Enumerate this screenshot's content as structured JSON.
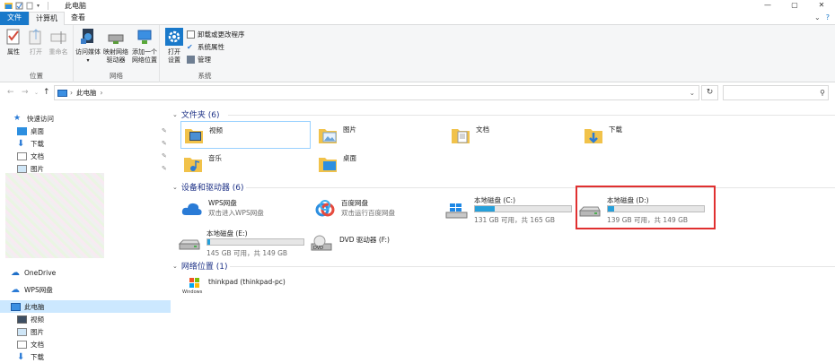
{
  "window": {
    "title": "此电脑"
  },
  "ribbon_tabs": [
    "文件",
    "计算机",
    "查看"
  ],
  "ribbon": {
    "location_group": {
      "label": "位置",
      "properties": "属性",
      "open": "打开",
      "rename": "重命名"
    },
    "network_group": {
      "label": "网络",
      "access_media": "访问媒体",
      "map_drive": "映射网络\n驱动器",
      "add_location": "添加一个\n网络位置"
    },
    "system_group": {
      "label": "系统",
      "open_settings": "打开\n设置",
      "uninstall": "卸载或更改程序",
      "sys_props": "系统属性",
      "manage": "管理"
    }
  },
  "address": {
    "path": "此电脑",
    "search_placeholder": ""
  },
  "nav": {
    "quick_access": "快速访问",
    "qa_items": [
      "桌面",
      "下载",
      "文档",
      "图片"
    ],
    "onedrive": "OneDrive",
    "wps": "WPS网盘",
    "this_pc": "此电脑",
    "pc_items": [
      "视频",
      "图片",
      "文档",
      "下载"
    ]
  },
  "sections": {
    "folders": "文件夹 (6)",
    "devices": "设备和驱动器 (6)",
    "network": "网络位置 (1)"
  },
  "folders": [
    "视频",
    "图片",
    "文档",
    "下载",
    "音乐",
    "桌面"
  ],
  "apps": [
    {
      "name": "WPS网盘",
      "sub": "双击进入WPS网盘"
    },
    {
      "name": "百度网盘",
      "sub": "双击运行百度网盘"
    }
  ],
  "drives": [
    {
      "name": "本地磁盘 (C:)",
      "sub": "131 GB 可用，共 165 GB",
      "used_fraction": 0.21
    },
    {
      "name": "本地磁盘 (D:)",
      "sub": "139 GB 可用，共 149 GB",
      "used_fraction": 0.07
    },
    {
      "name": "本地磁盘 (E:)",
      "sub": "145 GB 可用，共 149 GB",
      "used_fraction": 0.03
    },
    {
      "name": "DVD 驱动器 (F:)"
    }
  ],
  "network_items": [
    {
      "name": "thinkpad (thinkpad-pc)",
      "icon_text": "Windows"
    }
  ],
  "colors": {
    "accent": "#1979ca",
    "bar_fill": "#26a0da",
    "highlight": "#e03030",
    "selection": "#cce8ff"
  }
}
